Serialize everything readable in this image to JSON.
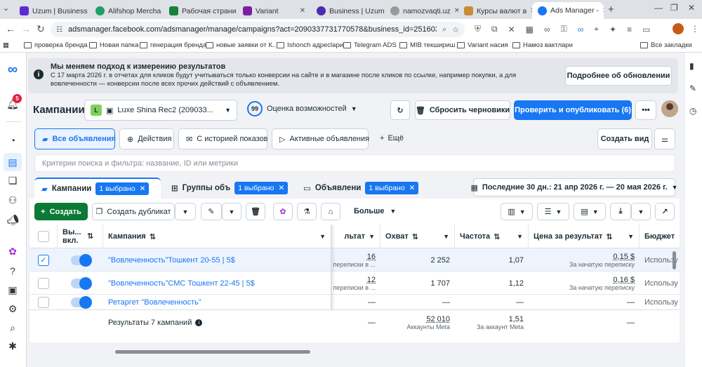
{
  "browser": {
    "tabs": [
      {
        "label": "Uzum | Business",
        "color": "#5b2bd1"
      },
      {
        "label": "Alifshop Mercha",
        "color": "#1aa163"
      },
      {
        "label": "Рабочая страни",
        "color": "#188038"
      },
      {
        "label": "Variant",
        "color": "#7a1fa2"
      },
      {
        "label": "Business | Uzum",
        "color": "#4b2bb0"
      },
      {
        "label": "namozvaqti.uz",
        "color": "#777777"
      },
      {
        "label": "Курсы валют в",
        "color": "#c98b3a"
      },
      {
        "label": "Ads Manager - ",
        "color": "#1877f2"
      }
    ],
    "url": "adsmanager.facebook.com/adsmanager/manage/campaigns?act=2090337731770578&business_id=2516037567689206?&gl...",
    "bookmarks": [
      "проверка бренда",
      "Новая папка",
      "генерация бренда",
      "новые заявки от К...",
      "Ishonch адресlари",
      "Telegram ADS",
      "MIB текшириш",
      "Variant насия",
      "Намоз вактлари",
      "Все закладки"
    ]
  },
  "nav": {
    "notif_count": "5"
  },
  "banner": {
    "title": "Мы меняем подход к измерению результатов",
    "text": "С 17 марта 2026 г. в отчетах для кликов будут учитываться только конверсии на сайте и в магазине после кликов по ссылке, например покупки, а для вовлеченности — конверсии после всех прочих действий с объявлением.",
    "button": "Подробнее об обновлении"
  },
  "header": {
    "title": "Кампании",
    "account_letter": "L",
    "account": "Luxe Shina Rec2 (209033...",
    "score": "99",
    "score_label": "Оценка возможностей",
    "discard": "Сбросить черновики",
    "publish": "Проверить и опубликовать (6)"
  },
  "views": {
    "tabs": [
      "Все объявления",
      "Действия",
      "С историей показов",
      "Активные объявления"
    ],
    "more": "Ещё",
    "create_view": "Создать вид"
  },
  "search": {
    "placeholder": "Критерии поиска и фильтра: название, ID или метрики"
  },
  "levels": {
    "campaigns": "Кампании",
    "adsets": "Группы объ",
    "ads": "Объявлени",
    "selected": "1 выбрано",
    "date": "Последние 30 дн.: 21 апр 2026 г. — 20 мая 2026 г."
  },
  "toolbar": {
    "create": "Создать",
    "duplicate": "Создать дубликат",
    "more": "Больше"
  },
  "table": {
    "headers": {
      "onoff": "Вы... вкл.",
      "campaign": "Кампания",
      "result": "льтат",
      "reach": "Охват",
      "freq": "Частота",
      "cost": "Цена за результат",
      "budget": "Бюджет"
    },
    "rows": [
      {
        "name": "\"Вовлеченность\"Тошкент 20-55 | 5$",
        "result": "16",
        "result_sub": "переписки в ...",
        "reach": "2 252",
        "freq": "1,07",
        "cost": "0,15 $",
        "cost_sub": "За начатую переписку",
        "budget": "Использу"
      },
      {
        "name": "\"Вовлеченность\"СМС Тошкент 22-45 | 5$",
        "result": "12",
        "result_sub": "переписки в ...",
        "reach": "1 707",
        "freq": "1,12",
        "cost": "0,16 $",
        "cost_sub": "За начатую переписку",
        "budget": "Использу"
      },
      {
        "name": "Ретаргет \"Вовлеченность\"",
        "result": "—",
        "result_sub": "",
        "reach": "—",
        "freq": "—",
        "cost": "—",
        "cost_sub": "",
        "budget": "Использу"
      }
    ],
    "total": {
      "label": "Результаты 7 кампаний",
      "result": "—",
      "reach": "52 010",
      "reach_sub": "Аккаунты Meta",
      "freq": "1,51",
      "freq_sub": "За аккаунт Meta",
      "cost": "—"
    }
  }
}
